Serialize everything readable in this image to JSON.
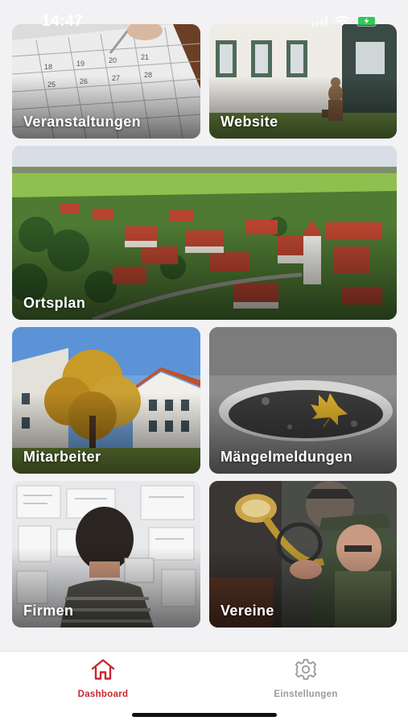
{
  "status_bar": {
    "time": "14:47",
    "signal_icon": "cellular-signal-icon",
    "wifi_icon": "wifi-icon",
    "battery_icon": "battery-charging-icon",
    "battery_color": "#34c759"
  },
  "tiles": [
    {
      "label": "Veranstaltungen"
    },
    {
      "label": "Website"
    },
    {
      "label": "Ortsplan"
    },
    {
      "label": "Mitarbeiter"
    },
    {
      "label": "Mängelmeldungen"
    },
    {
      "label": "Firmen"
    },
    {
      "label": "Vereine"
    }
  ],
  "tabbar": {
    "active_color": "#c8262e",
    "inactive_color": "#9a9a9f",
    "tabs": [
      {
        "label": "Dashboard",
        "icon": "home-icon",
        "active": true
      },
      {
        "label": "Einstellungen",
        "icon": "gear-icon",
        "active": false
      }
    ]
  }
}
